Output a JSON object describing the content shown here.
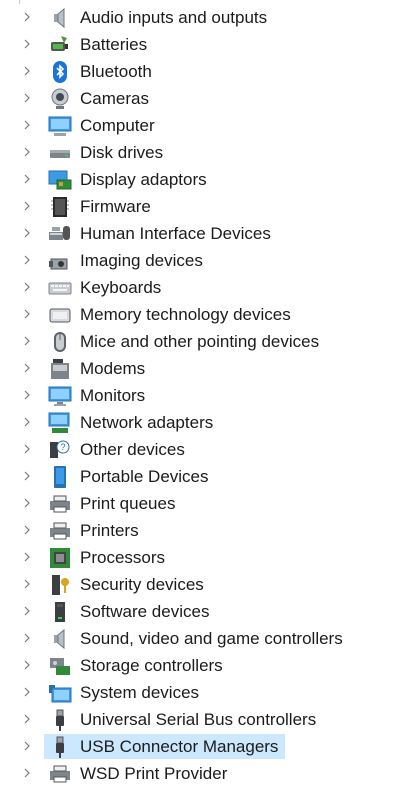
{
  "device_tree": {
    "items": [
      {
        "label": "Audio inputs and outputs",
        "icon": "speaker-icon"
      },
      {
        "label": "Batteries",
        "icon": "battery-icon"
      },
      {
        "label": "Bluetooth",
        "icon": "bluetooth-icon"
      },
      {
        "label": "Cameras",
        "icon": "camera-icon"
      },
      {
        "label": "Computer",
        "icon": "computer-icon"
      },
      {
        "label": "Disk drives",
        "icon": "disk-drive-icon"
      },
      {
        "label": "Display adaptors",
        "icon": "display-adapter-icon"
      },
      {
        "label": "Firmware",
        "icon": "firmware-chip-icon"
      },
      {
        "label": "Human Interface Devices",
        "icon": "hid-icon"
      },
      {
        "label": "Imaging devices",
        "icon": "imaging-device-icon"
      },
      {
        "label": "Keyboards",
        "icon": "keyboard-icon"
      },
      {
        "label": "Memory technology devices",
        "icon": "memory-card-icon"
      },
      {
        "label": "Mice and other pointing devices",
        "icon": "mouse-icon"
      },
      {
        "label": "Modems",
        "icon": "modem-icon"
      },
      {
        "label": "Monitors",
        "icon": "monitor-icon"
      },
      {
        "label": "Network adapters",
        "icon": "network-adapter-icon"
      },
      {
        "label": "Other devices",
        "icon": "unknown-device-icon"
      },
      {
        "label": "Portable Devices",
        "icon": "portable-device-icon"
      },
      {
        "label": "Print queues",
        "icon": "print-queue-icon"
      },
      {
        "label": "Printers",
        "icon": "printer-icon"
      },
      {
        "label": "Processors",
        "icon": "processor-icon"
      },
      {
        "label": "Security devices",
        "icon": "security-device-icon"
      },
      {
        "label": "Software devices",
        "icon": "software-device-icon"
      },
      {
        "label": "Sound, video and game controllers",
        "icon": "sound-controller-icon"
      },
      {
        "label": "Storage controllers",
        "icon": "storage-controller-icon"
      },
      {
        "label": "System devices",
        "icon": "system-devices-icon"
      },
      {
        "label": "Universal Serial Bus controllers",
        "icon": "usb-icon"
      },
      {
        "label": "USB Connector Managers",
        "icon": "usb-connector-icon",
        "selected": true
      },
      {
        "label": "WSD Print Provider",
        "icon": "wsd-printer-icon"
      }
    ]
  },
  "colors": {
    "selection": "#cce8ff",
    "chevron": "#7a7a7a",
    "text": "#1b1b1b"
  }
}
